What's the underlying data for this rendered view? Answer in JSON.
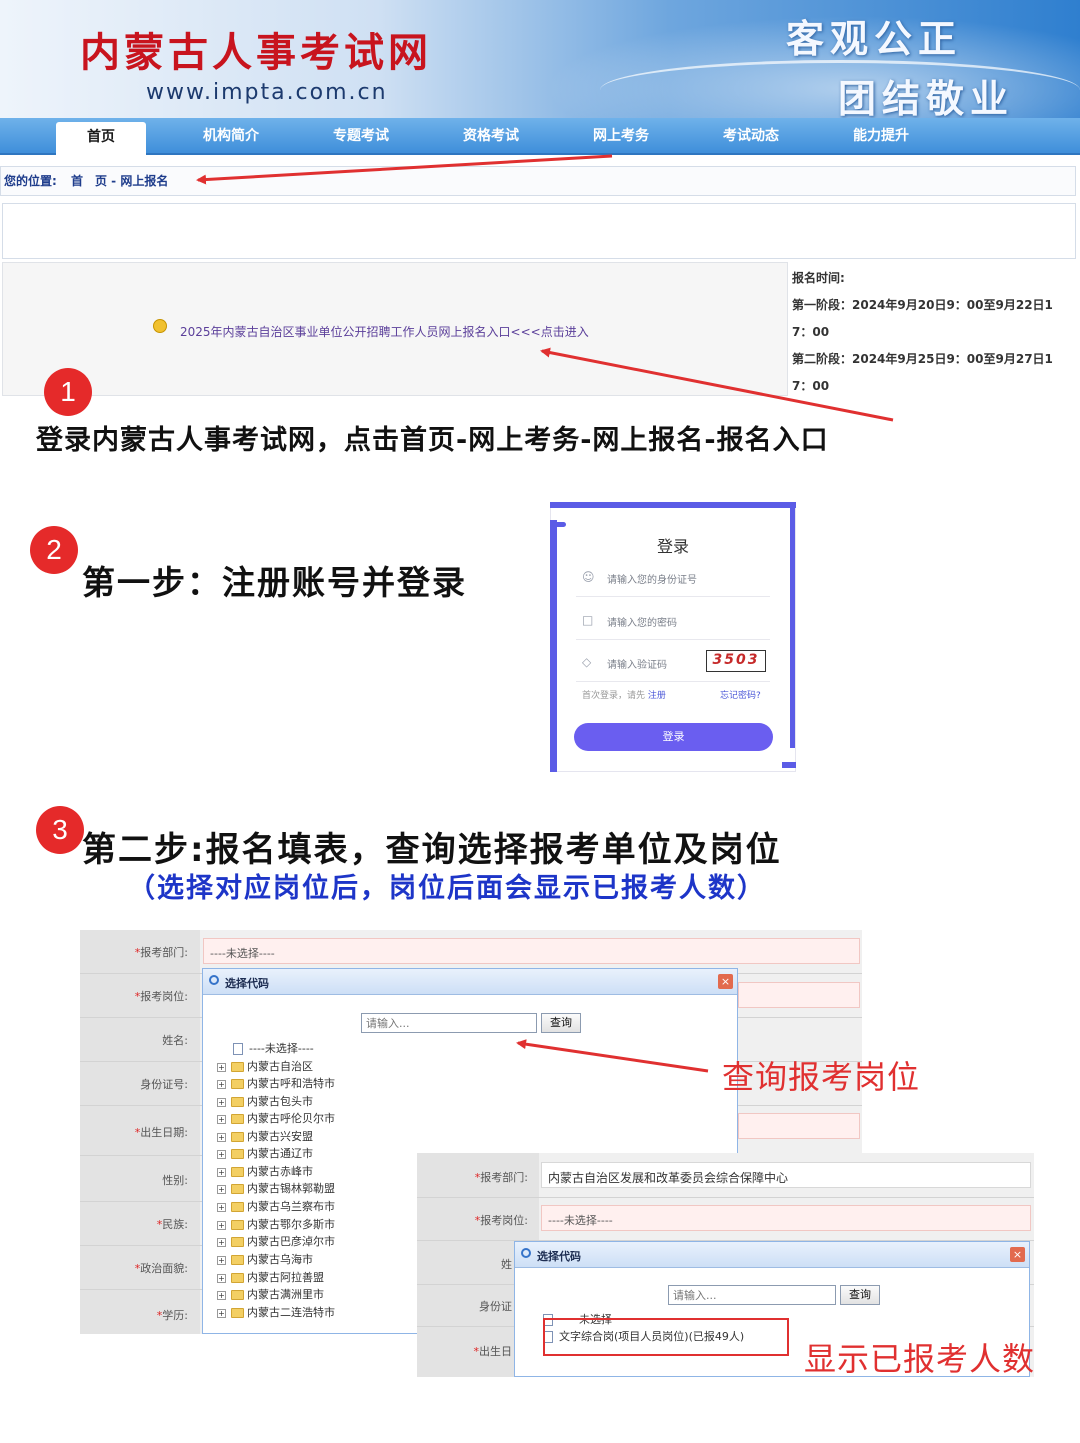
{
  "site": {
    "title": "内蒙古人事考试网",
    "url": "www.impta.com.cn",
    "motto1": "客观公正",
    "motto2": "团结敬业"
  },
  "nav": [
    "首页",
    "机构简介",
    "专题考试",
    "资格考试",
    "网上考务",
    "考试动态",
    "能力提升"
  ],
  "breadcrumb": {
    "prefix": "您的位置:",
    "path": "首　页 - 网上报名"
  },
  "notice": {
    "link": "2025年内蒙古自治区事业单位公开招聘工作人员网上报名入口<<<点击进入",
    "time_title": "报名时间:",
    "stage1": "第一阶段：2024年9月20日9：00至9月22日1",
    "stage1_cont": "7：00",
    "stage2": "第二阶段：2024年9月25日9：00至9月27日1",
    "stage2_cont": "7：00"
  },
  "steps": {
    "n1": "1",
    "n2": "2",
    "n3": "3",
    "instr1": "登录内蒙古人事考试网，点击首页-网上考务-网上报名-报名入口",
    "step1": "第一步：注册账号并登录",
    "step2": "第二步:报名填表，查询选择报考单位及岗位",
    "step2_sub": "（选择对应岗位后，岗位后面会显示已报考人数）"
  },
  "login": {
    "title": "登录",
    "id_placeholder": "请输入您的身份证号",
    "pwd_placeholder": "请输入您的密码",
    "captcha_placeholder": "请输入验证码",
    "captcha": "3503",
    "hint": "首次登录，请先",
    "register": "注册",
    "forgot": "忘记密码?",
    "button": "登录"
  },
  "form1": {
    "labels": [
      {
        "req": "*",
        "text": "报考部门:"
      },
      {
        "req": "*",
        "text": "报考岗位:"
      },
      {
        "req": "",
        "text": "姓名:"
      },
      {
        "req": "",
        "text": "身份证号:"
      },
      {
        "req": "*",
        "text": "出生日期:"
      },
      {
        "req": "",
        "text": "性别:"
      },
      {
        "req": "*",
        "text": "民族:"
      },
      {
        "req": "*",
        "text": "政治面貌:"
      },
      {
        "req": "*",
        "text": "学历:"
      }
    ],
    "dept_value": "----未选择----",
    "popup": {
      "title": "选择代码",
      "input_placeholder": "请输入...",
      "query": "查询",
      "none": "----未选择----",
      "items": [
        "内蒙古自治区",
        "内蒙古呼和浩特市",
        "内蒙古包头市",
        "内蒙古呼伦贝尔市",
        "内蒙古兴安盟",
        "内蒙古通辽市",
        "内蒙古赤峰市",
        "内蒙古锡林郭勒盟",
        "内蒙古乌兰察布市",
        "内蒙古鄂尔多斯市",
        "内蒙古巴彦淖尔市",
        "内蒙古乌海市",
        "内蒙古阿拉善盟",
        "内蒙古满洲里市",
        "内蒙古二连浩特市"
      ]
    },
    "annotation": "查询报考岗位"
  },
  "form2": {
    "labels": [
      {
        "req": "*",
        "text": "报考部门:"
      },
      {
        "req": "*",
        "text": "报考岗位:"
      },
      {
        "req": "",
        "text": "姓"
      },
      {
        "req": "",
        "text": "身份证"
      },
      {
        "req": "*",
        "text": "出生日"
      }
    ],
    "dept_value": "内蒙古自治区发展和改革委员会综合保障中心",
    "post_value": "----未选择----",
    "popup": {
      "title": "选择代码",
      "input_placeholder": "请输入...",
      "query": "查询",
      "none": "未选择",
      "result": "文字综合岗(项目人员岗位)(已报49人)"
    },
    "annotation": "显示已报考人数"
  },
  "colors": {
    "accent_red": "#e03030",
    "nav_blue": "#3f8fda",
    "login_purple": "#6a5ef0",
    "subtitle_blue": "#1d35c8"
  }
}
